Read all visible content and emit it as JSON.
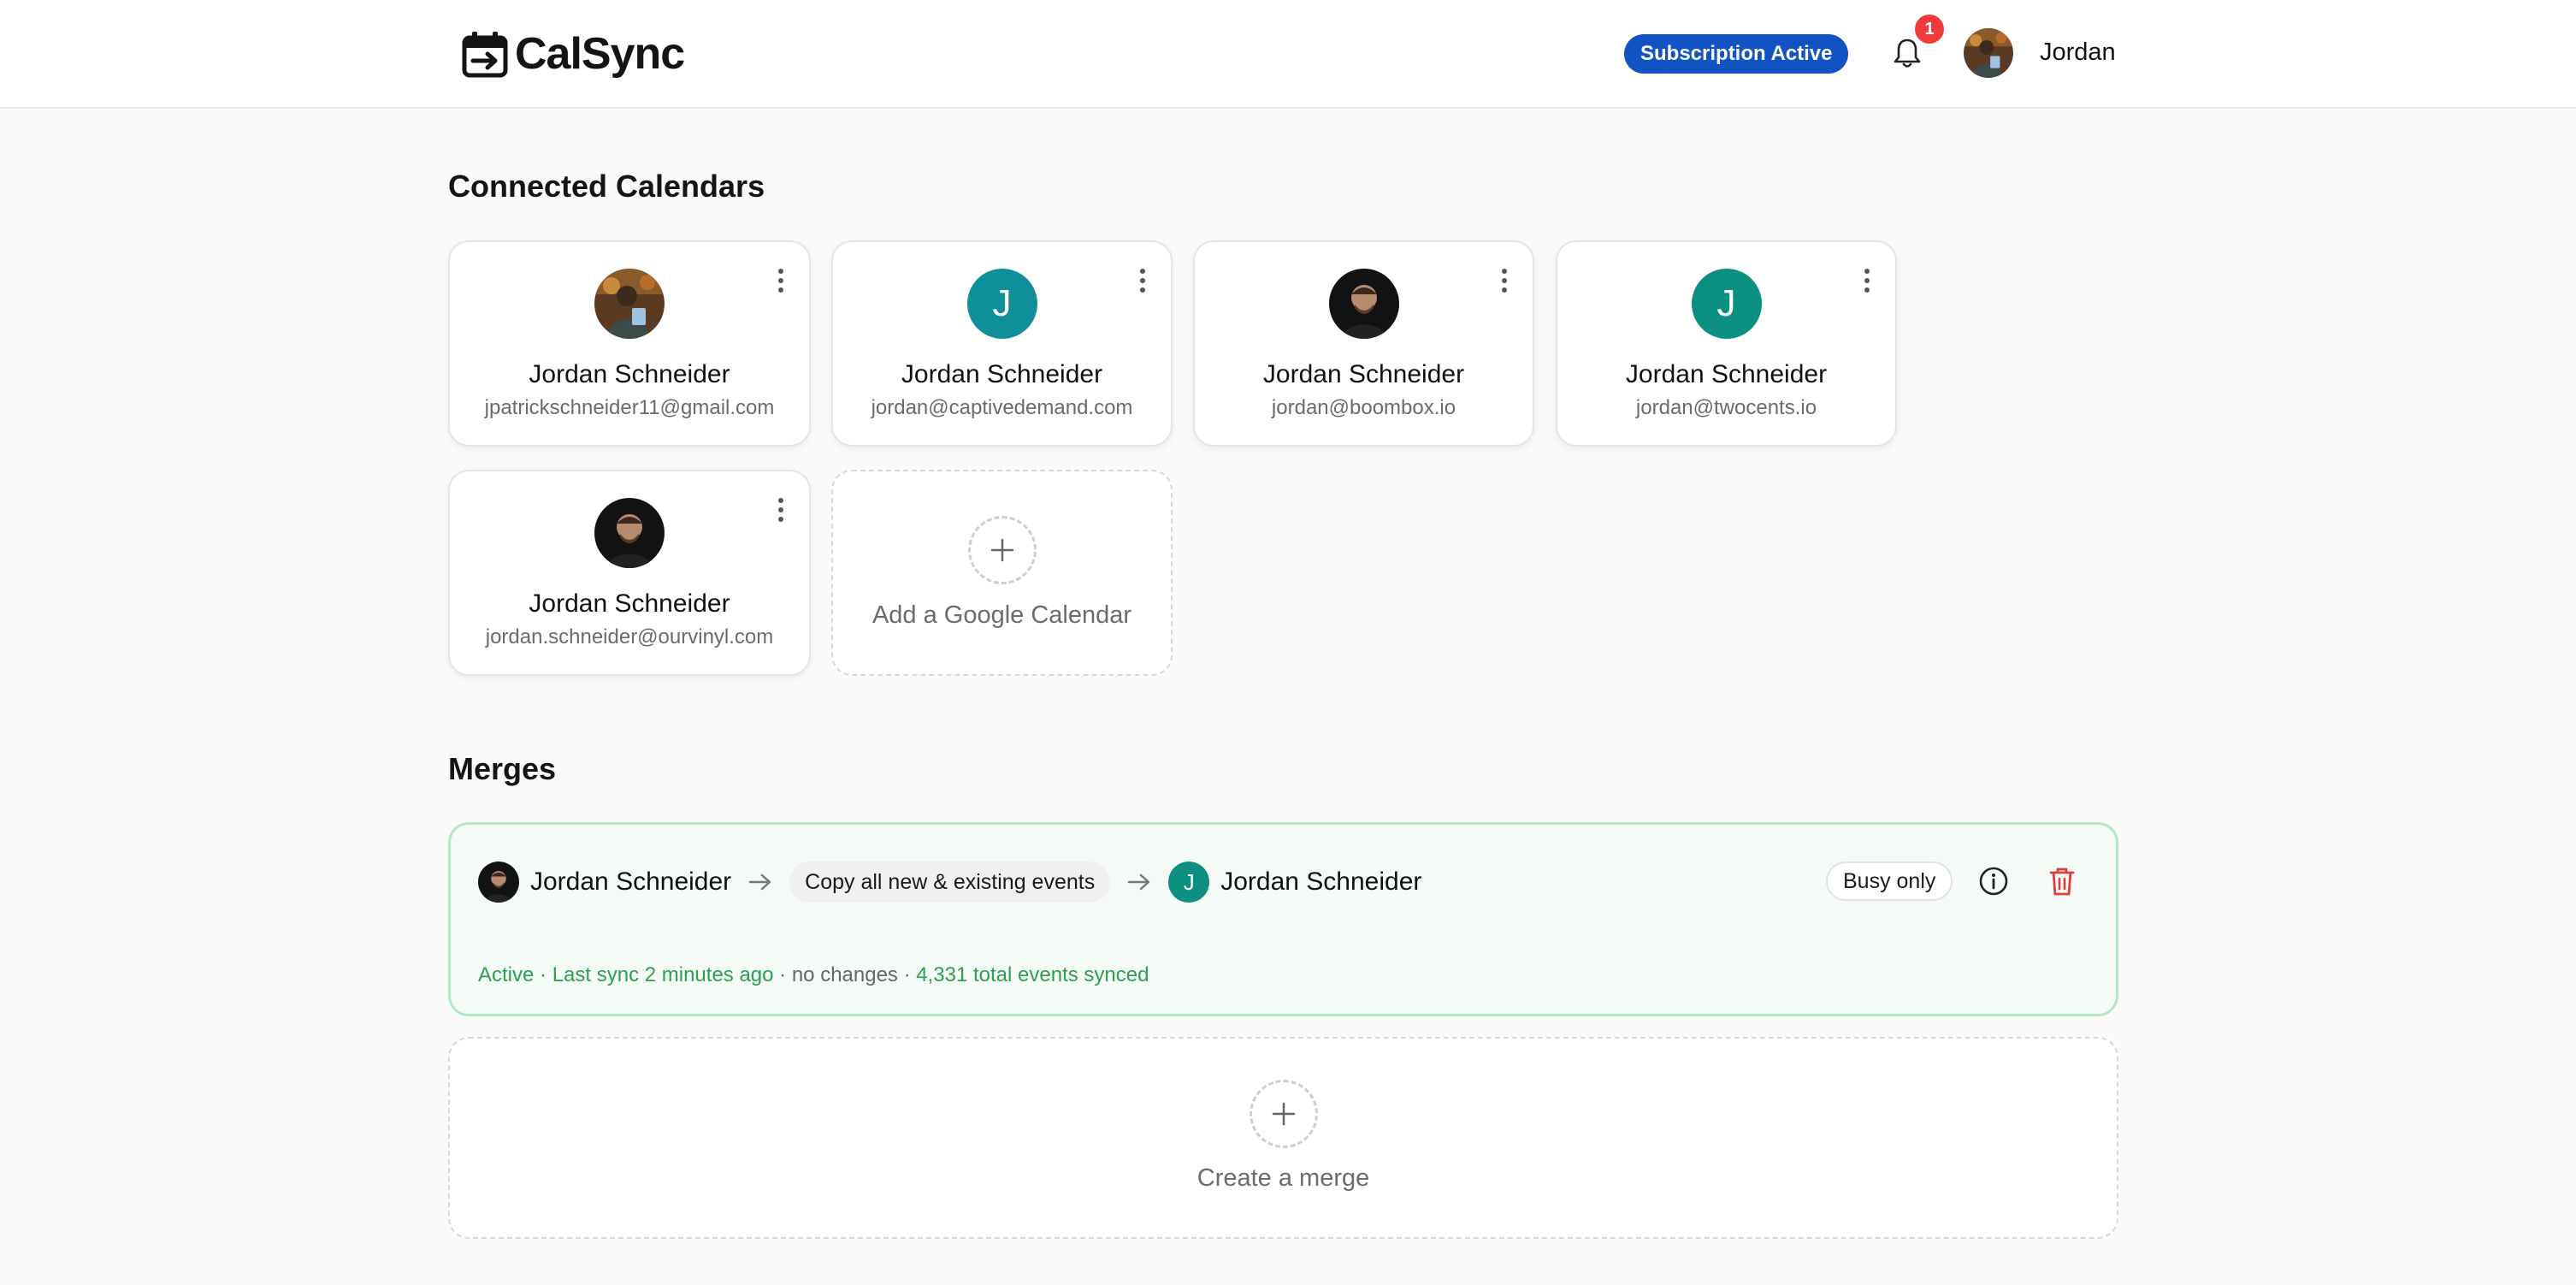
{
  "app": {
    "name": "CalSync"
  },
  "header": {
    "subscription_badge": "Subscription Active",
    "notification_count": "1",
    "user_name": "Jordan"
  },
  "calendars": {
    "title": "Connected Calendars",
    "items": [
      {
        "name": "Jordan Schneider",
        "email": "jpatrickschneider11@gmail.com",
        "avatar": "photo"
      },
      {
        "name": "Jordan Schneider",
        "email": "jordan@captivedemand.com",
        "avatar": "J"
      },
      {
        "name": "Jordan Schneider",
        "email": "jordan@boombox.io",
        "avatar": "photo"
      },
      {
        "name": "Jordan Schneider",
        "email": "jordan@twocents.io",
        "avatar": "J"
      },
      {
        "name": "Jordan Schneider",
        "email": "jordan.schneider@ourvinyl.com",
        "avatar": "photo"
      }
    ],
    "add_label": "Add a Google Calendar"
  },
  "merges": {
    "title": "Merges",
    "items": [
      {
        "source_name": "Jordan Schneider",
        "rule": "Copy all new & existing events",
        "target_name": "Jordan Schneider",
        "target_avatar": "J",
        "visibility": "Busy only",
        "status": "Active",
        "last_sync": "Last sync 2 minutes ago",
        "changes": "no changes",
        "total": "4,331 total events synced",
        "separator": " · "
      }
    ],
    "create_label": "Create a merge"
  },
  "colors": {
    "brand_blue": "#1153c2",
    "notification_red": "#ef3b3b",
    "active_green": "#2e9e4f",
    "delete_red": "#e23b3b",
    "avatar_teal": "#0a8f80"
  },
  "icons": [
    "calendar-logo-icon",
    "bell-icon",
    "kebab-menu-icon",
    "plus-icon",
    "arrow-right-icon",
    "info-icon",
    "trash-icon"
  ]
}
